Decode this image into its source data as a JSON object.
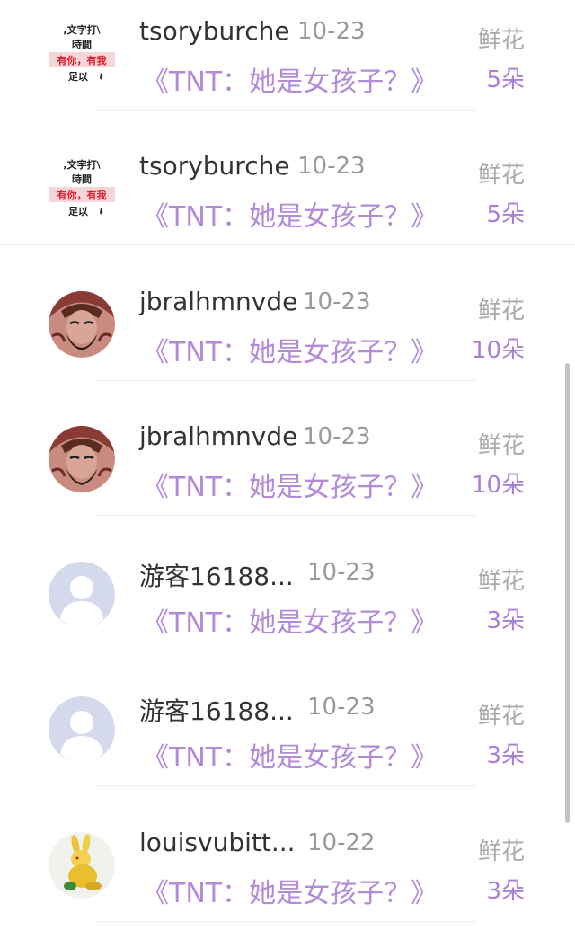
{
  "rows": [
    {
      "avatar": "text-image-avatar",
      "avatar_text": [
        ",文字打\\",
        "時間",
        "有你，有我",
        "足以"
      ],
      "username": "tsoryburche",
      "time": "10-23",
      "gift_type": "鲜花",
      "title": "《TNT：她是女孩子？》",
      "amount": "5朵"
    },
    {
      "avatar": "text-image-avatar",
      "avatar_text": [
        ",文字打\\",
        "時間",
        "有你，有我",
        "足以"
      ],
      "username": "tsoryburche",
      "time": "10-23",
      "gift_type": "鲜花",
      "title": "《TNT：她是女孩子？》",
      "amount": "5朵"
    },
    {
      "avatar": "warrior-portrait-avatar",
      "username": "jbralhmnvde",
      "time": "10-23",
      "gift_type": "鲜花",
      "title": "《TNT：她是女孩子？》",
      "amount": "10朵"
    },
    {
      "avatar": "warrior-portrait-avatar",
      "username": "jbralhmnvde",
      "time": "10-23",
      "gift_type": "鲜花",
      "title": "《TNT：她是女孩子？》",
      "amount": "10朵"
    },
    {
      "avatar": "default-user-avatar",
      "username": "游客16188...",
      "time": "10-23",
      "gift_type": "鲜花",
      "title": "《TNT：她是女孩子？》",
      "amount": "3朵"
    },
    {
      "avatar": "default-user-avatar",
      "username": "游客16188...",
      "time": "10-23",
      "gift_type": "鲜花",
      "title": "《TNT：她是女孩子？》",
      "amount": "3朵"
    },
    {
      "avatar": "golden-rabbit-avatar",
      "username": "louisvubitt...",
      "time": "10-22",
      "gift_type": "鲜花",
      "title": "《TNT：她是女孩子？》",
      "amount": "3朵"
    }
  ],
  "colors": {
    "title": "#b28ad8",
    "amount": "#a97fd6",
    "username": "#333333",
    "time": "#999999",
    "gift_type": "#aaaaaa"
  }
}
